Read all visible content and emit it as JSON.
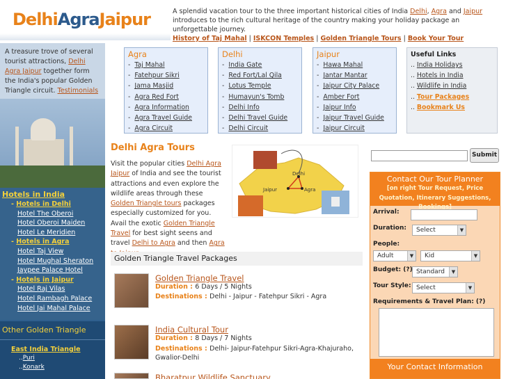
{
  "logo": {
    "part1": "Delhi",
    "part2": "Agra",
    "part3": "Jaipur"
  },
  "tagline": {
    "text1": "A splendid vacation tour to the three important historical cities of India ",
    "delhi": "Delhi",
    "comma": ", ",
    "agra": "Agra",
    "and": " and ",
    "jaipur": "Jaipur",
    "text2": " introduces to the rich cultural heritage of the country making your holiday package an unforgettable journey.",
    "links": [
      "History of Taj Mahal",
      "ISKCON Temples",
      "Golden Triangle Tours",
      "Book Your Tour"
    ],
    "sep": " | "
  },
  "intro": {
    "text1": "A treasure trove of several tourist attractions, ",
    "link": "Delhi Agra Jaipur",
    "text2": " together form the India's popular Golden Triangle circuit.  ",
    "testimonials": "Testimonials"
  },
  "hotels": {
    "head": "Hotels in India",
    "groups": [
      {
        "title": "Hotels in Delhi",
        "items": [
          "Hotel The Oberoi",
          "Hotel Oberoi Maiden",
          "Hotel Le Meridien"
        ]
      },
      {
        "title": "Hotels in Agra",
        "items": [
          "Hotel Taj View",
          "Hotel Mughal Sheraton",
          "Jaypee Palace Hotel"
        ]
      },
      {
        "title": "Hotels in Jaipur",
        "items": [
          "Hotel Raj Vilas",
          "Hotel Rambagh Palace",
          "Hotel Jai Mahal Palace"
        ]
      }
    ]
  },
  "other": {
    "head": "Other Golden Triangle",
    "sub": "East India Triangle",
    "items": [
      "Puri",
      "Konark"
    ]
  },
  "cities": [
    {
      "title": "Agra",
      "items": [
        "Taj Mahal",
        "Fatehpur Sikri",
        "Jama Masjid",
        "Agra Red Fort",
        "Agra Information",
        "Agra Travel Guide",
        "Agra Circuit"
      ]
    },
    {
      "title": "Delhi",
      "items": [
        "India Gate",
        "Red Fort/Lal Qila",
        "Lotus Temple",
        "Humayun's Tomb",
        "Delhi Info",
        "Delhi Travel Guide",
        "Delhi Circuit"
      ]
    },
    {
      "title": "Jaipur",
      "items": [
        "Hawa Mahal",
        "Jantar Mantar",
        "Jaipur City Palace",
        "Amber Fort",
        "Jaipur Info",
        "Jaipur Travel Guide",
        "Jaipur Circuit"
      ]
    }
  ],
  "useful": {
    "title": "Useful Links",
    "items": [
      "India Holidays",
      "Hotels in India",
      "Wildlife in India",
      "Tour Packages",
      "Bookmark Us"
    ]
  },
  "tours": {
    "title": "Delhi Agra Tours",
    "t1": "Visit the popular cities ",
    "l1": "Delhi Agra Jaipur",
    "t2": " of India and see the tourist attractions and even explore the wildlife areas through these ",
    "l2": "Golden Triangle tours",
    "t3": " packages especially customized for you. Avail the exotic ",
    "l3": "Golden Triangle Travel",
    "t4": " for best sight seens and travel ",
    "l4": "Delhi to Agra",
    "t5": " and then ",
    "l5": "Agra to Jaipur",
    "t6": "."
  },
  "map_labels": {
    "delhi": "Delhi",
    "agra": "Agra",
    "jaipur": "Jaipur"
  },
  "packages": {
    "head": "Golden Triangle Travel Packages",
    "duration_label": "Duration : ",
    "destinations_label": "Destinations : ",
    "items": [
      {
        "title": "Golden Triangle Travel ",
        "duration": "6 Days / 5 Nights",
        "destinations": "Delhi - Jaipur - Fatehpur Sikri - Agra"
      },
      {
        "title": "India Cultural Tour",
        "duration": "8 Days / 7 Nights",
        "destinations": "Delhi- Jaipur-Fatehpur Sikri-Agra-Khajuraho, Gwalior-Delhi"
      },
      {
        "title": "Bharatpur Wildlife Sanctuary"
      }
    ]
  },
  "search": {
    "button": "Submit",
    "value": ""
  },
  "planner": {
    "title": "Contact Our Tour Planner",
    "subtitle": "[on right Tour Request, Price Quotation, Itinerary Suggestions, Bookings]",
    "arrival": "Arrival:",
    "duration": "Duration:",
    "duration_value": "Select",
    "people": "People:",
    "adult": "Adult",
    "kid": "Kid",
    "budget": "Budget: (?)",
    "budget_value": "Standard",
    "style": "Tour Style:",
    "style_value": "Select",
    "requirements": "Requirements & Travel Plan: (?)",
    "footer": "Your Contact Information"
  },
  "colors": {
    "orange": "#e8821a",
    "navy": "#2f5f8e",
    "yellow": "#f3d03b"
  }
}
